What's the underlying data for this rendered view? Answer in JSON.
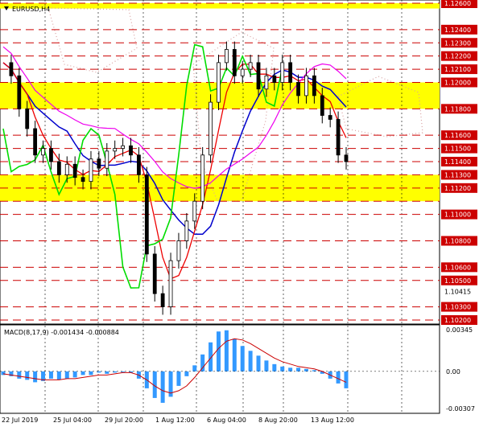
{
  "header": {
    "symbol_label": "EURUSD,H4",
    "macd_label": "MACD(8,17,9) -0.001434 -0.000884"
  },
  "colors": {
    "price_label_red": "#cc0000",
    "price_label_current": "#000000",
    "support_resistance_line": "#cc0000",
    "zone_fill": "#ffff00",
    "grid": "#000000",
    "candles": "#000000",
    "green_line": "#00dd00",
    "red_line": "#ee0000",
    "blue_line": "#0000cc",
    "magenta_line": "#ee00ee",
    "macd_histogram": "#3399ff",
    "macd_signal": "#cc0000",
    "ichimoku_cloud_dots": "#d8a0a0"
  },
  "chart_data": [
    {
      "type": "candlestick",
      "title": "EURUSD,H4",
      "ylim": [
        1.102,
        1.126
      ],
      "price_labels": [
        {
          "text": "1.12600",
          "kind": "level"
        },
        {
          "text": "1.12400",
          "kind": "level"
        },
        {
          "text": "1.12300",
          "kind": "level"
        },
        {
          "text": "1.12200",
          "kind": "level"
        },
        {
          "text": "1.12100",
          "kind": "level"
        },
        {
          "text": "1.12000",
          "kind": "level"
        },
        {
          "text": "1.11800",
          "kind": "level"
        },
        {
          "text": "1.11600",
          "kind": "level"
        },
        {
          "text": "1.11500",
          "kind": "level"
        },
        {
          "text": "1.11400",
          "kind": "level"
        },
        {
          "text": "1.11300",
          "kind": "level"
        },
        {
          "text": "1.11200",
          "kind": "level"
        },
        {
          "text": "1.11000",
          "kind": "level"
        },
        {
          "text": "1.10800",
          "kind": "level"
        },
        {
          "text": "1.10600",
          "kind": "level"
        },
        {
          "text": "1.10500",
          "kind": "level"
        },
        {
          "text": "1.10415",
          "kind": "current"
        },
        {
          "text": "1.10300",
          "kind": "level"
        },
        {
          "text": "1.10200",
          "kind": "level"
        }
      ],
      "support_resistance_levels": [
        1.126,
        1.124,
        1.123,
        1.122,
        1.121,
        1.12,
        1.118,
        1.116,
        1.115,
        1.114,
        1.113,
        1.112,
        1.111,
        1.11,
        1.108,
        1.106,
        1.105,
        1.103,
        1.102
      ],
      "zones": [
        [
          1.118,
          1.12
        ],
        [
          1.111,
          1.113
        ],
        [
          1.1256,
          1.126
        ]
      ],
      "x_ticks": [
        "22 Jul 2019",
        "25 Jul 04:00",
        "29 Jul 20:00",
        "1 Aug 12:00",
        "6 Aug 04:00",
        "8 Aug 20:00",
        "13 Aug 12:00"
      ],
      "close_path": [
        1.1215,
        1.1205,
        1.118,
        1.1165,
        1.1145,
        1.115,
        1.114,
        1.113,
        1.1138,
        1.1128,
        1.1125,
        1.1142,
        1.1135,
        1.1148,
        1.115,
        1.1152,
        1.1145,
        1.113,
        1.107,
        1.104,
        1.103,
        1.1065,
        1.108,
        1.1095,
        1.111,
        1.1145,
        1.1185,
        1.1215,
        1.1225,
        1.1205,
        1.121,
        1.1215,
        1.1195,
        1.1205,
        1.12,
        1.1215,
        1.12,
        1.119,
        1.1205,
        1.119,
        1.1175,
        1.1172,
        1.1145,
        1.114
      ]
    },
    {
      "type": "bar",
      "title": "MACD(8,17,9) -0.001434 -0.000884",
      "ylim": [
        -0.00307,
        0.00345
      ],
      "y_tick_labels": [
        "0.00345",
        "0.00",
        "-0.00307"
      ],
      "histogram": [
        -0.0003,
        -0.0004,
        -0.0006,
        -0.0007,
        -0.0009,
        -0.0008,
        -0.0006,
        -0.0007,
        -0.0006,
        -0.0005,
        -0.0003,
        -0.0003,
        -0.0001,
        -0.0002,
        -0.0001,
        0.0,
        -0.0001,
        -0.0006,
        -0.0014,
        -0.0022,
        -0.0026,
        -0.0021,
        -0.0012,
        -0.0004,
        0.0005,
        0.0014,
        0.0024,
        0.0033,
        0.0034,
        0.0027,
        0.0021,
        0.0017,
        0.0013,
        0.0009,
        0.0006,
        0.0004,
        0.0003,
        0.0003,
        0.0002,
        0.0001,
        -0.0002,
        -0.0006,
        -0.001,
        -0.0014
      ],
      "signal": [
        -0.0002,
        -0.0003,
        -0.0004,
        -0.0005,
        -0.0006,
        -0.0007,
        -0.0007,
        -0.0007,
        -0.0006,
        -0.0006,
        -0.0005,
        -0.0004,
        -0.0003,
        -0.0003,
        -0.0002,
        -0.0001,
        -0.0001,
        -0.0003,
        -0.0007,
        -0.0012,
        -0.0016,
        -0.0018,
        -0.0016,
        -0.0012,
        -0.0005,
        0.0003,
        0.0011,
        0.0019,
        0.0025,
        0.0027,
        0.0026,
        0.0023,
        0.0019,
        0.0015,
        0.0011,
        0.0008,
        0.0006,
        0.0004,
        0.0003,
        0.0002,
        0.0,
        -0.0003,
        -0.0006,
        -0.0009
      ]
    }
  ]
}
